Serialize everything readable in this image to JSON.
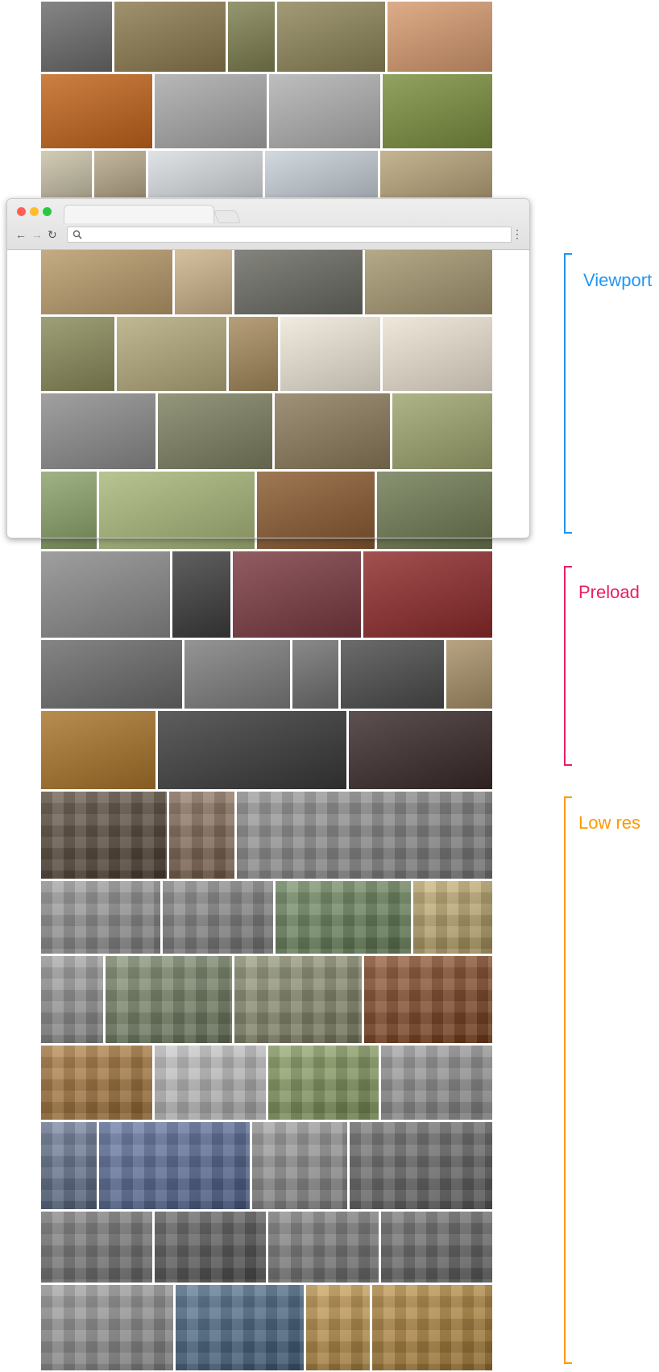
{
  "labels": {
    "viewport": "Viewport",
    "preload": "Preload",
    "low_res": "Low res"
  },
  "colors": {
    "viewport": "#2196f3",
    "preload": "#e91e63",
    "low_res": "#ff9800",
    "traffic_close": "#ff5f57",
    "traffic_minimize": "#ffbd2e",
    "traffic_zoom": "#28c940"
  },
  "browser": {
    "search_icon": "search-icon",
    "back_icon": "arrow-left-icon",
    "forward_icon": "arrow-right-icon",
    "reload_icon": "reload-icon",
    "menu_icon": "more-vert-icon"
  }
}
